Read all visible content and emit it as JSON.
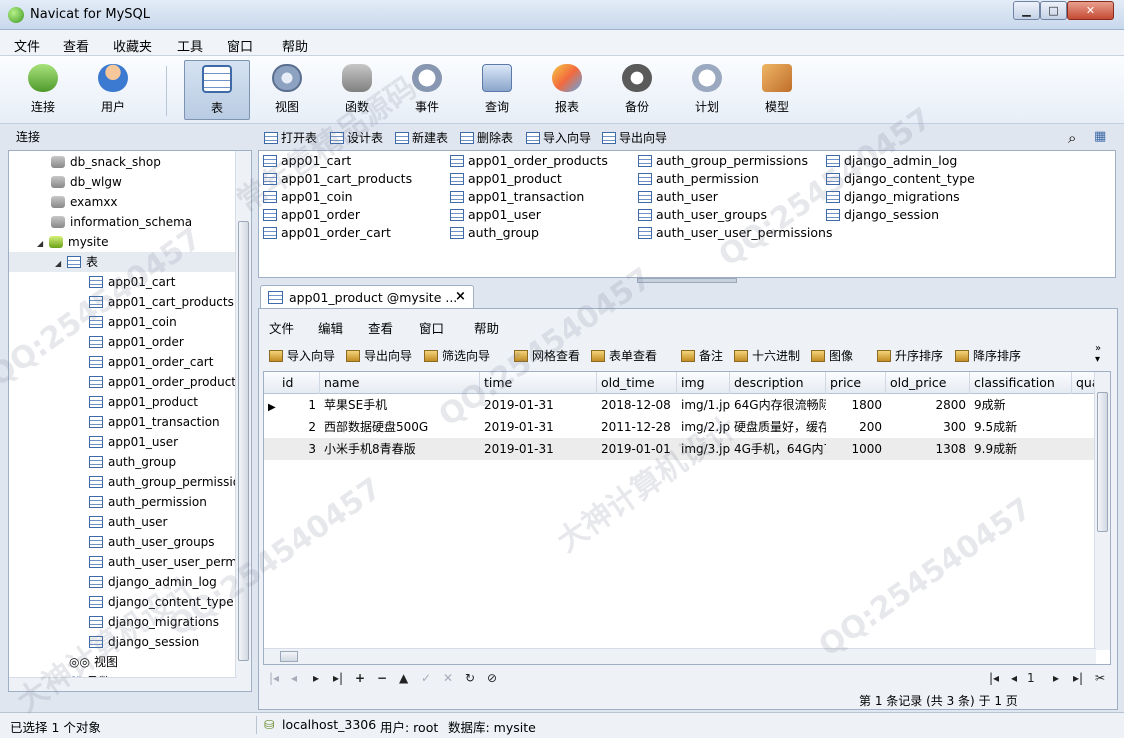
{
  "window": {
    "title": "Navicat for MySQL"
  },
  "menu": [
    "文件",
    "查看",
    "收藏夹",
    "工具",
    "窗口",
    "帮助"
  ],
  "toolbar": [
    "连接",
    "用户",
    "表",
    "视图",
    "函数",
    "事件",
    "查询",
    "报表",
    "备份",
    "计划",
    "模型"
  ],
  "left": {
    "header": "连接",
    "databases_top": [
      "db_snack_shop",
      "db_wlgw",
      "examxx",
      "information_schema"
    ],
    "current_db": "mysite",
    "tables_node": "表",
    "tables": [
      "app01_cart",
      "app01_cart_products",
      "app01_coin",
      "app01_order",
      "app01_order_cart",
      "app01_order_product",
      "app01_product",
      "app01_transaction",
      "app01_user",
      "auth_group",
      "auth_group_permissio",
      "auth_permission",
      "auth_user",
      "auth_user_groups",
      "auth_user_user_permi",
      "django_admin_log",
      "django_content_type",
      "django_migrations",
      "django_session"
    ],
    "views_node": "视图",
    "funcs_node": "函数"
  },
  "object_toolbar": [
    "打开表",
    "设计表",
    "新建表",
    "删除表",
    "导入向导",
    "导出向导"
  ],
  "objects": [
    [
      "app01_cart",
      "app01_cart_products",
      "app01_coin",
      "app01_order",
      "app01_order_cart"
    ],
    [
      "app01_order_products",
      "app01_product",
      "app01_transaction",
      "app01_user",
      "auth_group"
    ],
    [
      "auth_group_permissions",
      "auth_permission",
      "auth_user",
      "auth_user_groups",
      "auth_user_user_permissions"
    ],
    [
      "django_admin_log",
      "django_content_type",
      "django_migrations",
      "django_session"
    ]
  ],
  "tab": {
    "label": "app01_product @mysite ...",
    "close": "×"
  },
  "editor_menu": [
    "文件",
    "编辑",
    "查看",
    "窗口",
    "帮助"
  ],
  "editor_tools": [
    "导入向导",
    "导出向导",
    "筛选向导",
    "网格查看",
    "表单查看",
    "备注",
    "十六进制",
    "图像",
    "升序排序",
    "降序排序"
  ],
  "grid": {
    "columns": [
      "id",
      "name",
      "time",
      "old_time",
      "img",
      "description",
      "price",
      "old_price",
      "classification",
      "qua"
    ],
    "rows": [
      [
        "1",
        "苹果SE手机",
        "2019-01-31",
        "2018-12-08",
        "img/1.jp",
        "64G内存很流畅际",
        "1800",
        "2800",
        "9成新"
      ],
      [
        "2",
        "西部数据硬盘500G",
        "2019-01-31",
        "2011-12-28",
        "img/2.jp",
        "硬盘质量好，缓存",
        "200",
        "300",
        "9.5成新"
      ],
      [
        "3",
        "小米手机8青春版",
        "2019-01-31",
        "2019-01-01",
        "img/3.jp",
        "4G手机，64G内7",
        "1000",
        "1308",
        "9.9成新"
      ]
    ]
  },
  "nav": {
    "page": "1",
    "record_status": "第 1 条记录 (共 3 条) 于 1 页"
  },
  "status": {
    "selection": "已选择 1 个对象",
    "connection": "localhost_3306",
    "user": "用户: root",
    "database": "数据库: mysite"
  },
  "watermark": [
    "QQ:254540457",
    "大神计算机设计",
    "常年售精品源码"
  ]
}
